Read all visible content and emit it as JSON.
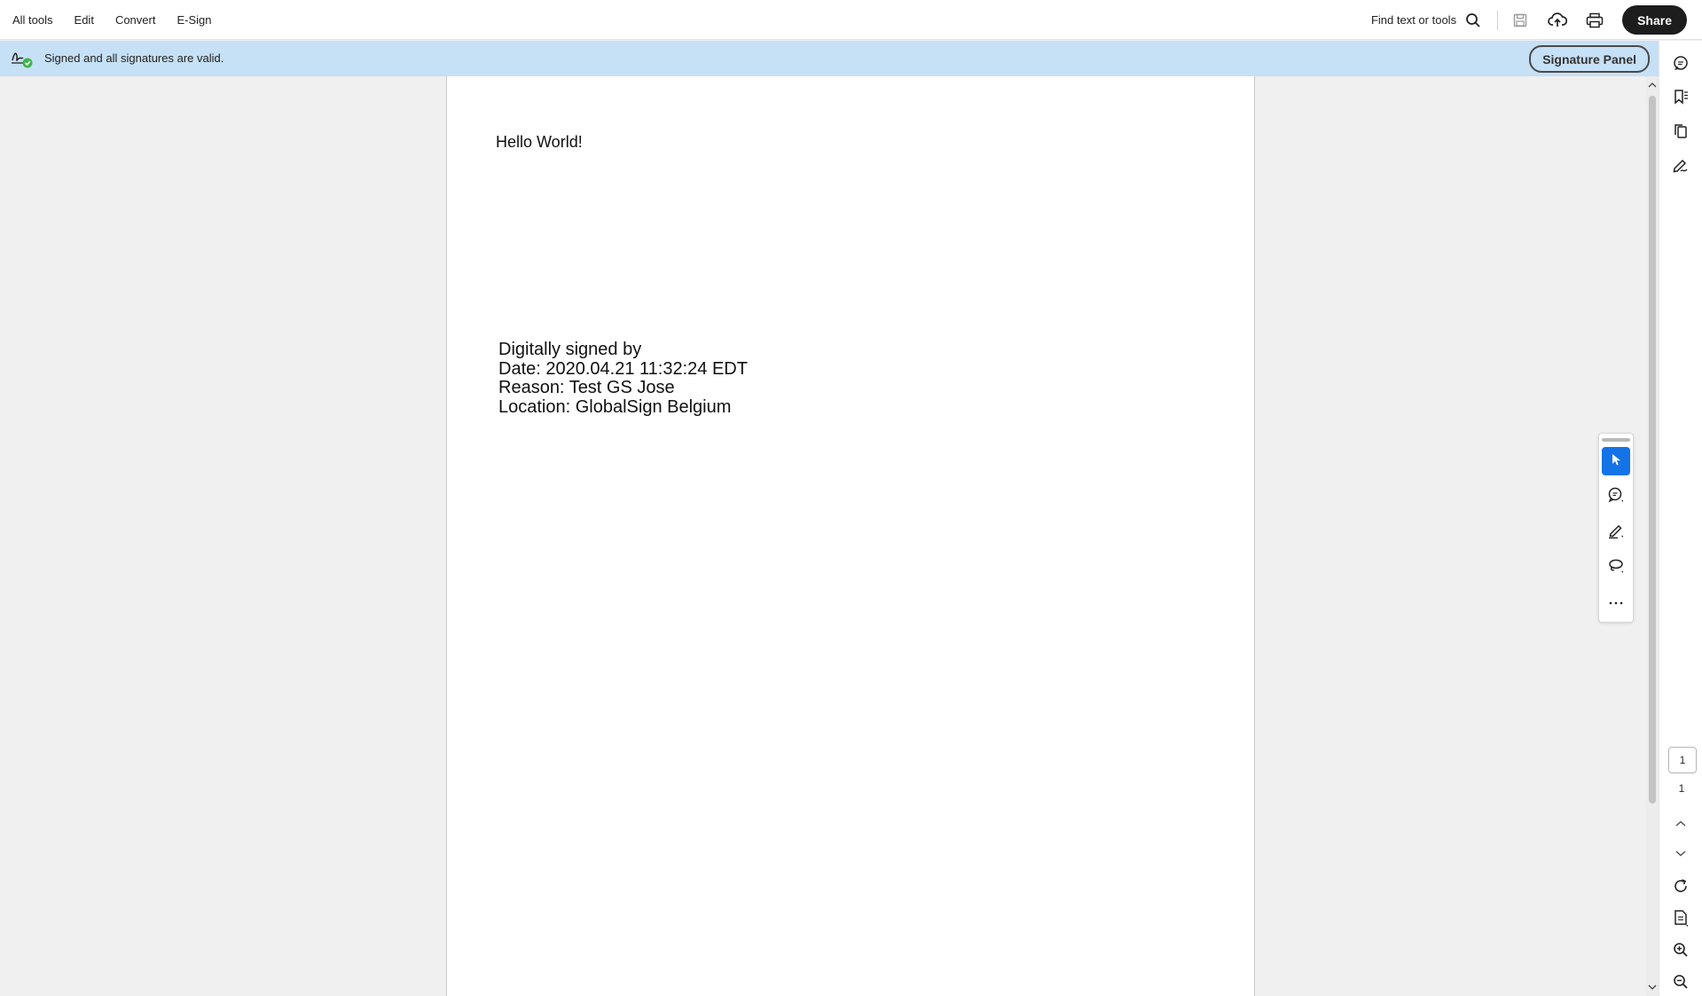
{
  "topbar": {
    "menu": [
      "All tools",
      "Edit",
      "Convert",
      "E-Sign"
    ],
    "find_label": "Find text or tools",
    "share_label": "Share",
    "icons": [
      "search-icon",
      "save-icon",
      "upload-icon",
      "print-icon"
    ]
  },
  "signature_banner": {
    "message": "Signed and all signatures are valid.",
    "panel_button": "Signature Panel",
    "status_color": "#3bb54a",
    "background": "#c6e0f5"
  },
  "document": {
    "hello": "Hello World!",
    "signature_lines": [
      "Digitally signed by",
      "Date: 2020.04.21 11:32:24 EDT",
      "Reason: Test GS Jose",
      "Location: GlobalSign Belgium"
    ]
  },
  "right_rail": {
    "icons": [
      "comment-icon",
      "bookmark-icon",
      "pages-icon",
      "fill-sign-icon",
      "rotate-icon",
      "page-document-icon",
      "zoom-in-icon",
      "zoom-out-icon"
    ],
    "current_page": "1",
    "total_pages": "1"
  },
  "floating_toolbar": {
    "tools": [
      "select-tool",
      "comment-tool",
      "highlight-pen-tool",
      "draw-lasso-tool",
      "more-tools"
    ],
    "active_tool": "select-tool",
    "accent_color": "#1473e6"
  }
}
